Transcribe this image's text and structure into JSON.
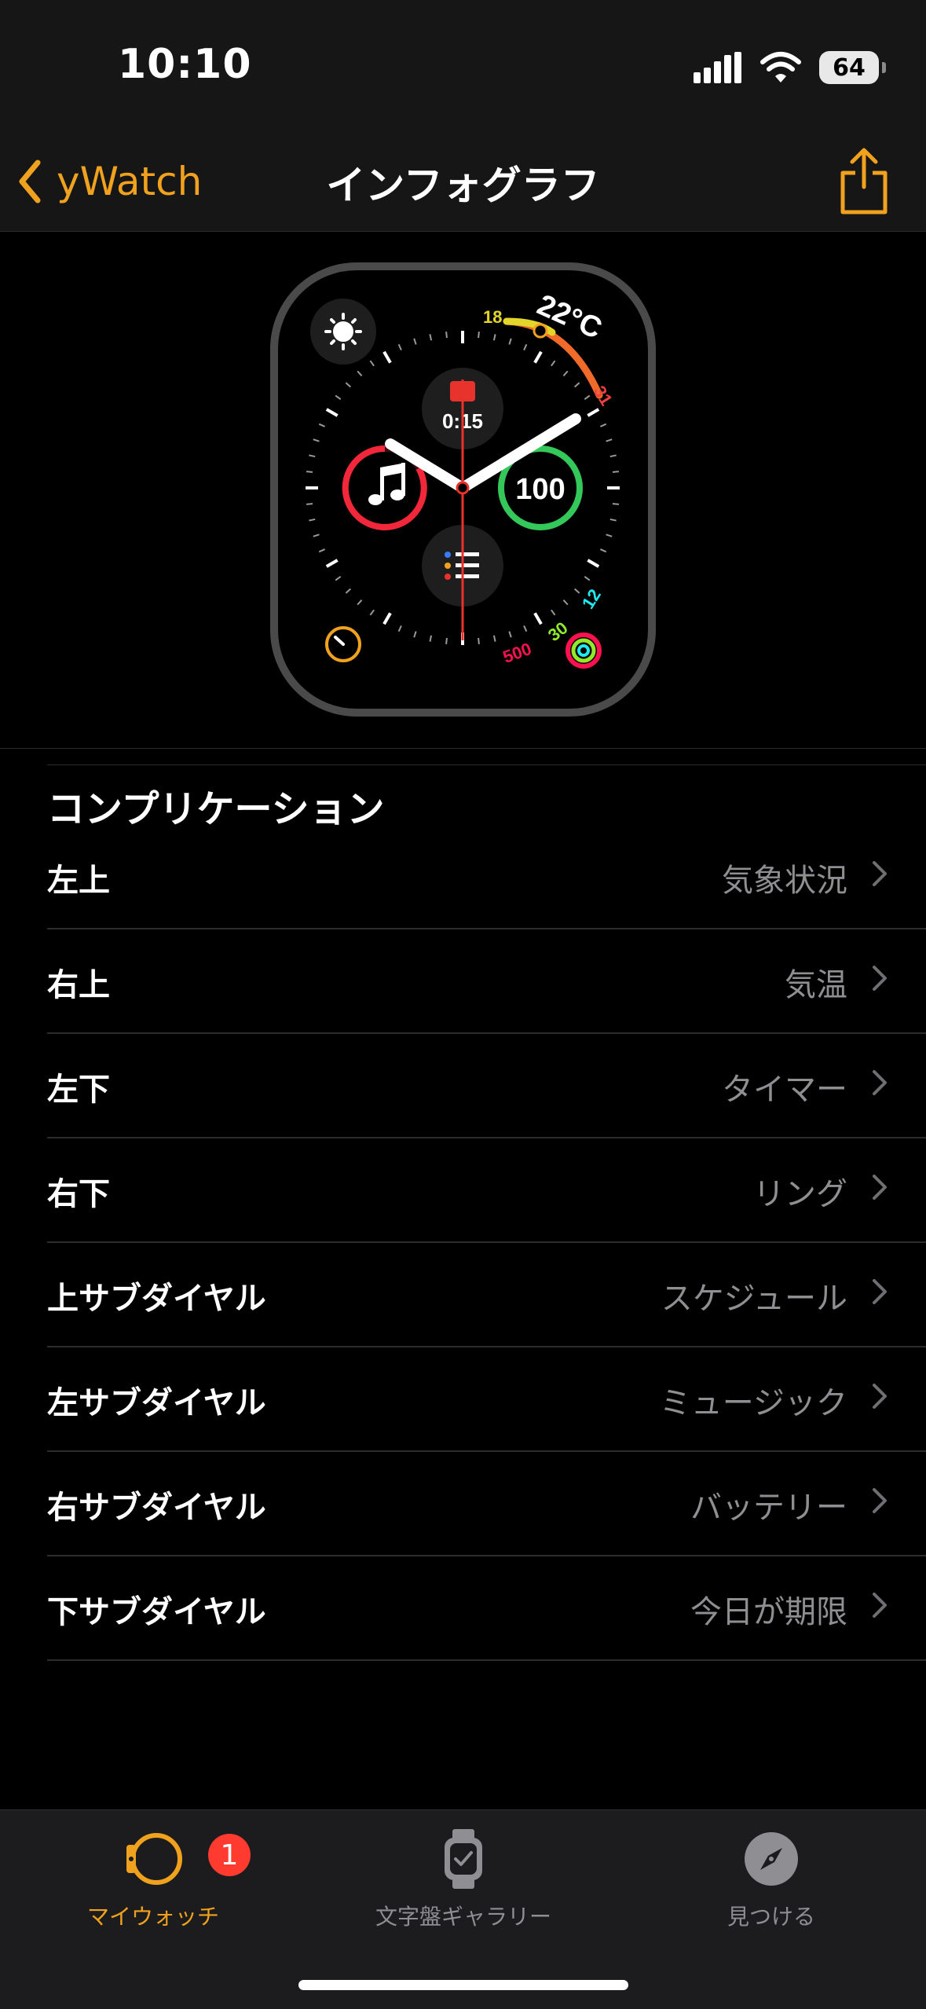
{
  "status": {
    "time": "10:10",
    "battery": "64"
  },
  "nav": {
    "back_label": "yWatch",
    "title": "インフォグラフ"
  },
  "watch": {
    "temp": "22°C",
    "temp_min": "18",
    "temp_max": "31",
    "calendar_time": "0:15",
    "battery_value": "100",
    "rings": {
      "move": "500",
      "exercise": "30",
      "stand": "12"
    }
  },
  "section": {
    "title": "コンプリケーション"
  },
  "complications": [
    {
      "label": "左上",
      "value": "気象状況"
    },
    {
      "label": "右上",
      "value": "気温"
    },
    {
      "label": "左下",
      "value": "タイマー"
    },
    {
      "label": "右下",
      "value": "リング"
    },
    {
      "label": "上サブダイヤル",
      "value": "スケジュール"
    },
    {
      "label": "左サブダイヤル",
      "value": "ミュージック"
    },
    {
      "label": "右サブダイヤル",
      "value": "バッテリー"
    },
    {
      "label": "下サブダイヤル",
      "value": "今日が期限"
    }
  ],
  "tabs": [
    {
      "label": "マイウォッチ",
      "icon": "watch-icon",
      "active": true,
      "badge": "1"
    },
    {
      "label": "文字盤ギャラリー",
      "icon": "watch-face-gallery-icon",
      "active": false
    },
    {
      "label": "見つける",
      "icon": "compass-icon",
      "active": false
    }
  ],
  "colors": {
    "accent": "#f0a21e",
    "secondary_text": "#8e8e93",
    "badge": "#ff3b30"
  }
}
